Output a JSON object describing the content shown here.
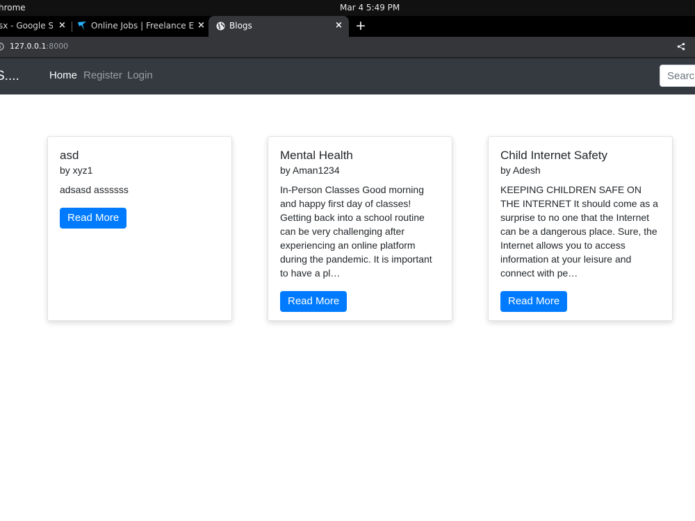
{
  "os": {
    "app_name": "hrome",
    "clock": "Mar 4  5:49 PM"
  },
  "tabs": [
    {
      "title": "sx - Google Sh",
      "close": "×"
    },
    {
      "title": "Online Jobs | Freelance Er",
      "close": "×",
      "icon": "freelancer-bird-icon"
    },
    {
      "title": "Blogs",
      "close": "×",
      "icon": "globe-icon"
    }
  ],
  "new_tab": "+",
  "address": {
    "host": "127.0.0.1",
    "port": ":8000"
  },
  "navbar": {
    "brand": "S....",
    "links": [
      "Home",
      "Register",
      "Login"
    ],
    "search_placeholder": "Search"
  },
  "posts": [
    {
      "title": "asd",
      "author": "by xyz1",
      "excerpt": "adsasd assssss",
      "button": "Read More"
    },
    {
      "title": "Mental Health",
      "author": "by Aman1234",
      "excerpt": "In-Person Classes Good morning and happy first day of classes! Getting back into a school routine can be very challenging after experiencing an online platform during the pandemic. It is important to have a pl…",
      "button": "Read More"
    },
    {
      "title": "Child Internet Safety",
      "author": "by Adesh",
      "excerpt": "KEEPING CHILDREN SAFE ON THE INTERNET It should come as a surprise to no one that the Internet can be a dangerous place. Sure, the Internet allows you to access information at your leisure and connect with pe…",
      "button": "Read More"
    }
  ],
  "colors": {
    "navbar_bg": "#343a40",
    "primary_button": "#007bff",
    "tab_active_bg": "#35363a"
  }
}
